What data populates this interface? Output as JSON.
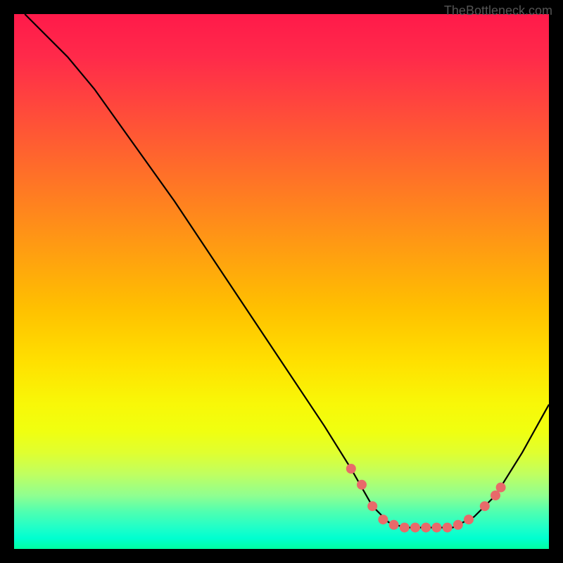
{
  "watermark": "TheBottleneck.com",
  "chart_data": {
    "type": "line",
    "title": "",
    "xlabel": "",
    "ylabel": "",
    "xlim": [
      0,
      100
    ],
    "ylim": [
      0,
      100
    ],
    "curve_points": [
      {
        "x": 2,
        "y": 100
      },
      {
        "x": 10,
        "y": 92
      },
      {
        "x": 15,
        "y": 86
      },
      {
        "x": 20,
        "y": 79
      },
      {
        "x": 30,
        "y": 65
      },
      {
        "x": 40,
        "y": 50
      },
      {
        "x": 50,
        "y": 35
      },
      {
        "x": 58,
        "y": 23
      },
      {
        "x": 63,
        "y": 15
      },
      {
        "x": 67,
        "y": 8
      },
      {
        "x": 70,
        "y": 5
      },
      {
        "x": 73,
        "y": 4
      },
      {
        "x": 78,
        "y": 4
      },
      {
        "x": 82,
        "y": 4
      },
      {
        "x": 86,
        "y": 6
      },
      {
        "x": 90,
        "y": 10
      },
      {
        "x": 95,
        "y": 18
      },
      {
        "x": 100,
        "y": 27
      }
    ],
    "marked_points": [
      {
        "x": 63,
        "y": 15
      },
      {
        "x": 65,
        "y": 12
      },
      {
        "x": 67,
        "y": 8
      },
      {
        "x": 69,
        "y": 5.5
      },
      {
        "x": 71,
        "y": 4.5
      },
      {
        "x": 73,
        "y": 4
      },
      {
        "x": 75,
        "y": 4
      },
      {
        "x": 77,
        "y": 4
      },
      {
        "x": 79,
        "y": 4
      },
      {
        "x": 81,
        "y": 4
      },
      {
        "x": 83,
        "y": 4.5
      },
      {
        "x": 85,
        "y": 5.5
      },
      {
        "x": 88,
        "y": 8
      },
      {
        "x": 90,
        "y": 10
      },
      {
        "x": 91,
        "y": 11.5
      }
    ],
    "background": "rainbow-gradient-vertical",
    "colors": {
      "top": "#ff1a4a",
      "middle": "#ffe000",
      "bottom": "#00ffa0",
      "curve": "#000000",
      "dots": "#e86a6a"
    }
  }
}
